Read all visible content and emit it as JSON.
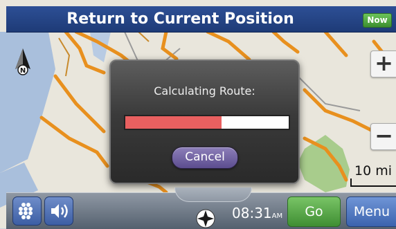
{
  "header": {
    "title": "Return to Current Position",
    "now_label": "Now"
  },
  "map": {
    "compass_label": "N",
    "zoom_in": "+",
    "zoom_out": "−",
    "scale_label": "10 mi"
  },
  "dialog": {
    "title": "Calculating Route:",
    "progress": 0.59,
    "cancel_label": "Cancel"
  },
  "bottom_bar": {
    "time": "08:31",
    "ampm": "AM",
    "go_label": "Go",
    "menu_label": "Menu"
  },
  "icons": [
    "compass-north-icon",
    "grid-dots-icon",
    "speaker-icon",
    "navigation-star-icon"
  ],
  "colors": {
    "header": "#1e3b77",
    "progress_fill": "#e96060",
    "go": "#3f8e33",
    "menu": "#3c63ae",
    "cancel": "#5c4d8f"
  }
}
